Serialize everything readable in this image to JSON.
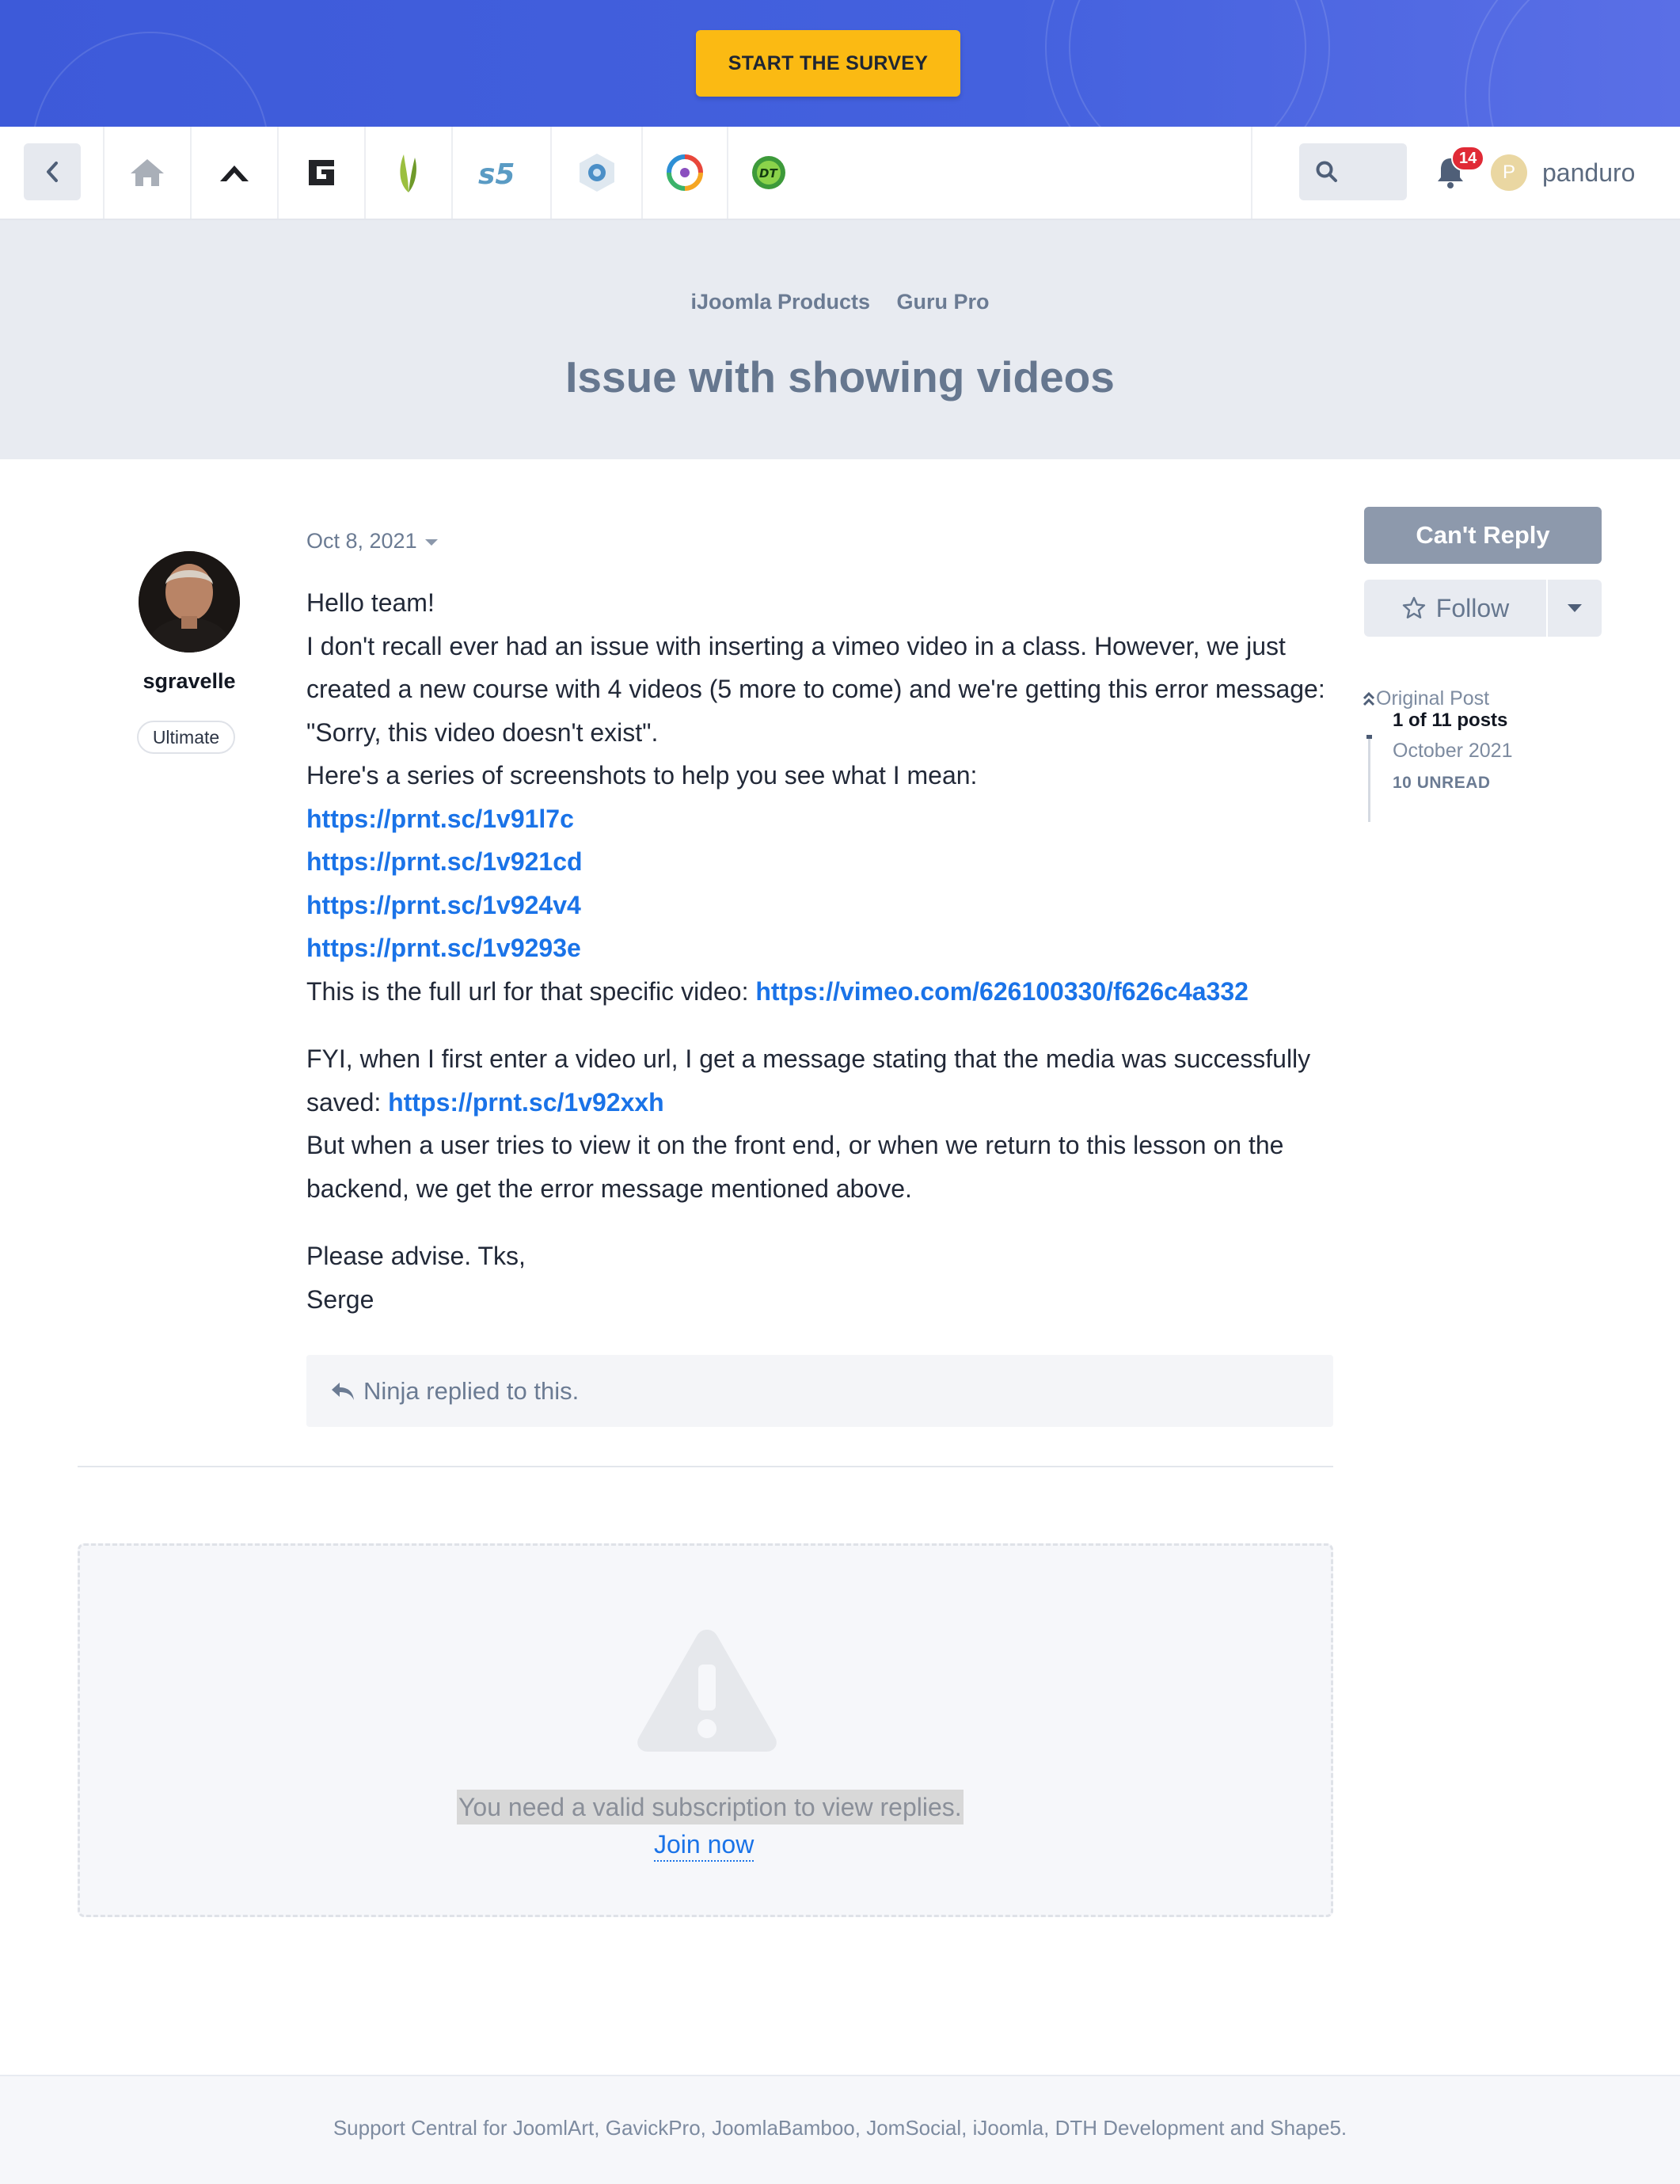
{
  "banner": {
    "survey_label": "START THE SURVEY"
  },
  "nav": {
    "icons": [
      "back-icon",
      "home-icon",
      "joomlart-icon",
      "gavickpro-icon",
      "joomlabamboo-icon",
      "shape5-icon",
      "ijoomla-icon",
      "jomsocial-icon",
      "dth-icon"
    ],
    "notifications_count": "14",
    "user_initial": "P",
    "username": "panduro"
  },
  "header": {
    "breadcrumb": [
      "iJoomla Products",
      "Guru Pro"
    ],
    "title": "Issue with showing videos"
  },
  "post": {
    "author": "sgravelle",
    "rank": "Ultimate",
    "date": "Oct 8, 2021",
    "lines": {
      "greeting": "Hello team!",
      "p1": "I don't recall ever had an issue with inserting a vimeo video in a class. However, we just created a new course with 4 videos (5 more to come) and we're getting this error message: \"Sorry, this video doesn't exist\".",
      "p2": "Here's a series of screenshots to help you see what I mean:",
      "link1": "https://prnt.sc/1v91l7c",
      "link2": "https://prnt.sc/1v921cd",
      "link3": "https://prnt.sc/1v924v4",
      "link4": "https://prnt.sc/1v9293e",
      "p3_prefix": "This is the full url for that specific video: ",
      "vimeo_link": "https://vimeo.com/626100330/f626c4a332",
      "p4_prefix": "FYI, when I first enter a video url, I get a message stating that the media was successfully saved: ",
      "link5": "https://prnt.sc/1v92xxh",
      "p5": "But when a user tries to view it on the front end, or when we return to this lesson on the backend, we get the error message mentioned above.",
      "p6": "Please advise. Tks,",
      "signature": "Serge"
    },
    "replied": "Ninja replied to this."
  },
  "restricted": {
    "message": "You need a valid subscription to view replies.",
    "join": "Join now"
  },
  "sidebar": {
    "cant_reply": "Can't Reply",
    "follow": "Follow",
    "original_post": "Original Post",
    "count": "1 of 11 posts",
    "month": "October 2021",
    "unread": "10 UNREAD"
  },
  "footer": {
    "text": "Support Central for JoomlArt, GavickPro, JoomlaBamboo, JomSocial, iJoomla, DTH Development and Shape5."
  },
  "colors": {
    "banner": "#4461de",
    "survey_button": "#fbba13",
    "link": "#1a73e8",
    "badge": "#e02a36"
  }
}
